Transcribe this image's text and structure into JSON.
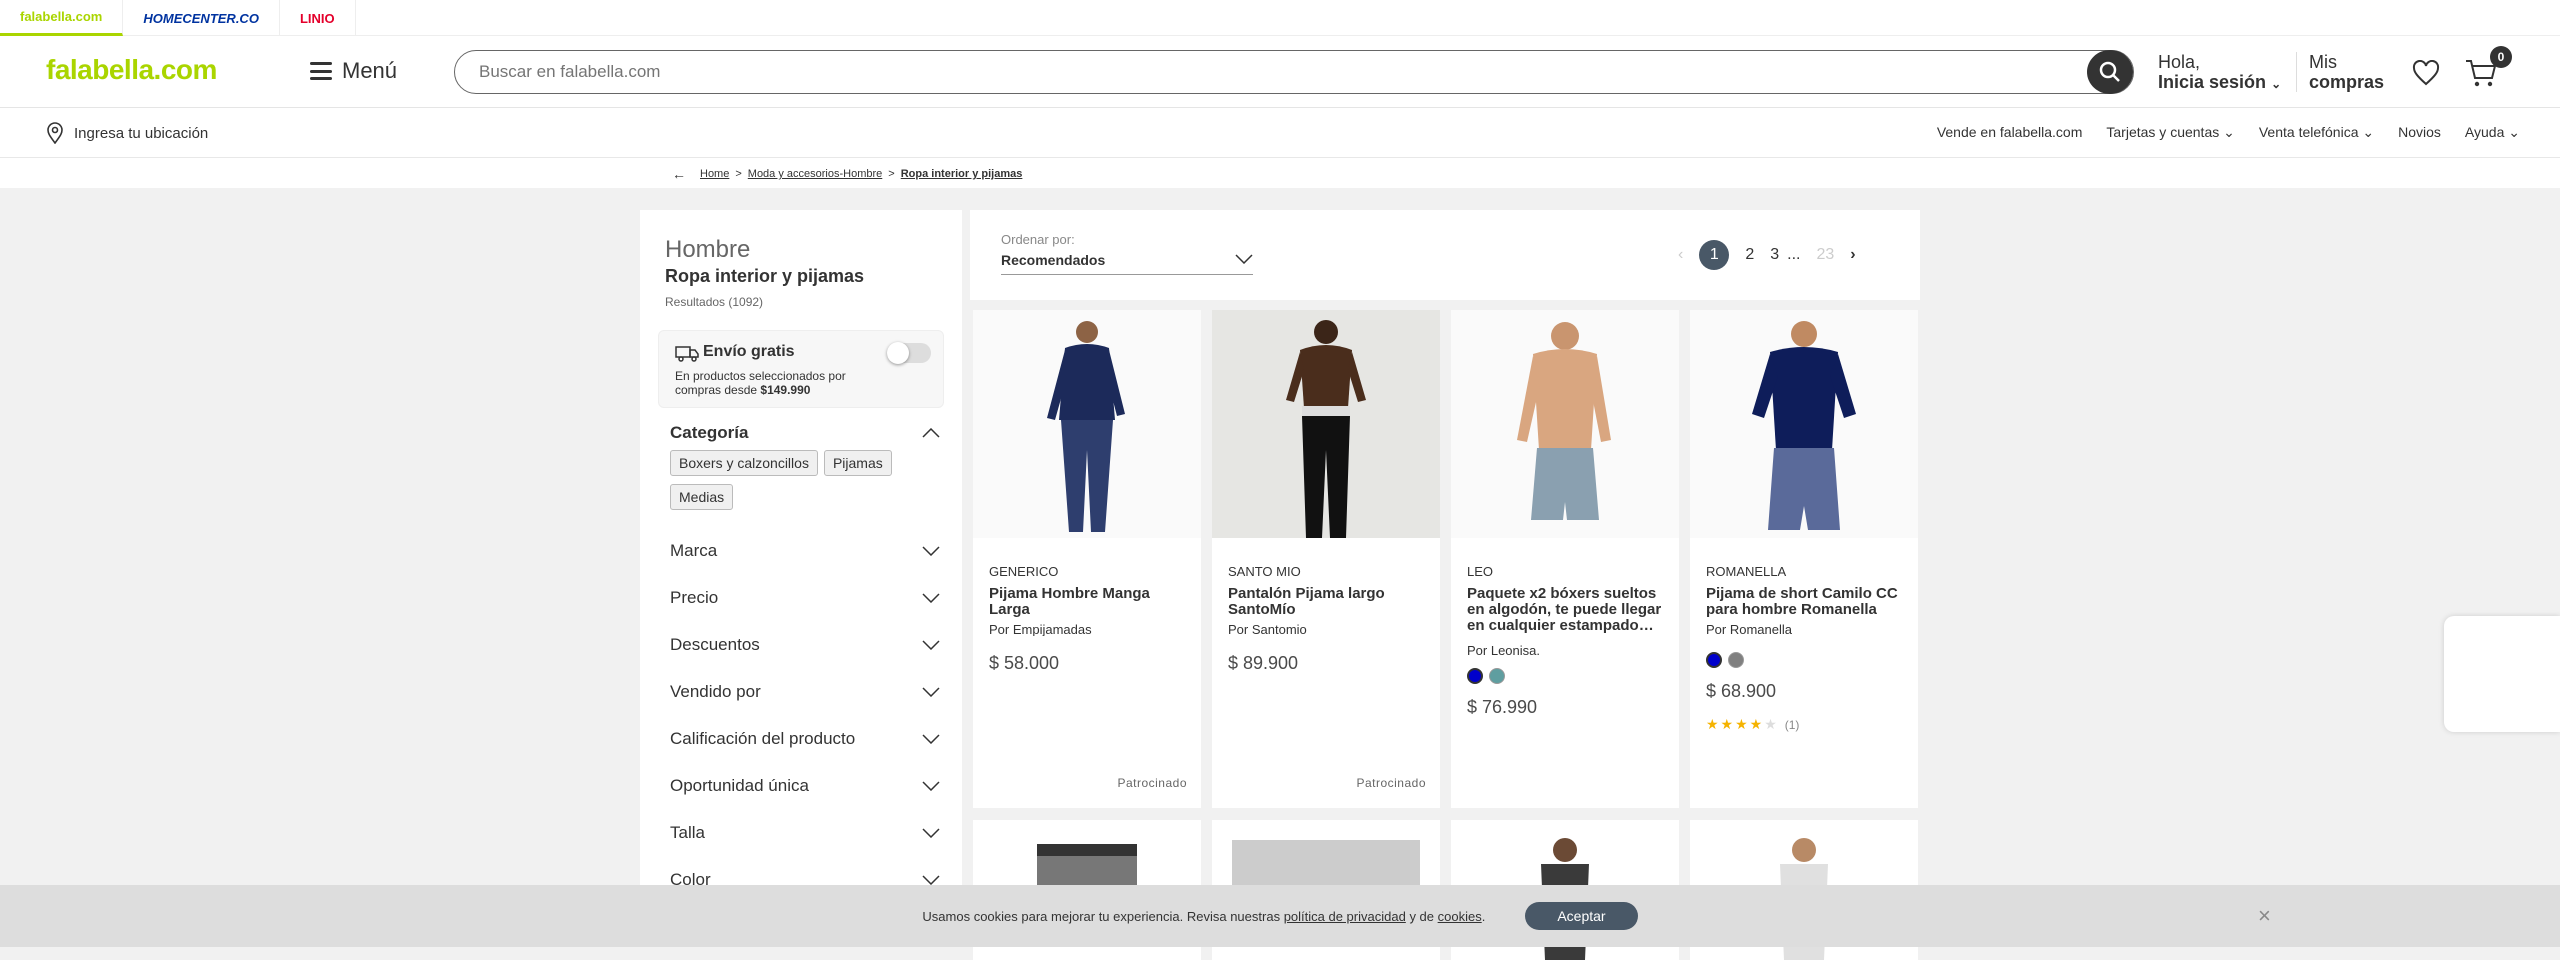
{
  "brands": [
    "falabella.com",
    "HOMECENTER.CO",
    "LINIO"
  ],
  "header": {
    "logo": "falabella.com",
    "menu_label": "Menú",
    "search_placeholder": "Buscar en falabella.com",
    "greeting": "Hola,",
    "login": "Inicia sesión",
    "purchases_1": "Mis",
    "purchases_2": "compras",
    "cart_count": "0"
  },
  "subnav": {
    "location": "Ingresa tu ubicación",
    "links": [
      "Vende en falabella.com",
      "Tarjetas y cuentas",
      "Venta telefónica",
      "Novios",
      "Ayuda"
    ]
  },
  "breadcrumb": [
    "Home",
    "Moda y accesorios-Hombre",
    "Ropa interior y pijamas"
  ],
  "sidebar": {
    "category": "Hombre",
    "subcategory": "Ropa interior y pijamas",
    "results": "Resultados (1092)",
    "shipping_title": "Envío gratis",
    "shipping_desc": "En productos seleccionados por compras desde ",
    "shipping_amount": "$149.990",
    "category_title": "Categoría",
    "chips": [
      "Boxers y calzoncillos",
      "Pijamas",
      "Medias"
    ],
    "filters": [
      "Marca",
      "Precio",
      "Descuentos",
      "Vendido por",
      "Calificación del producto",
      "Oportunidad única",
      "Talla",
      "Color"
    ]
  },
  "sort": {
    "label": "Ordenar por:",
    "value": "Recomendados"
  },
  "pagination": {
    "pages": [
      "1",
      "2",
      "3"
    ],
    "ellipsis": "...",
    "last": "23",
    "current": "1"
  },
  "products": [
    {
      "brand": "GENERICO",
      "name": "Pijama Hombre Manga Larga",
      "seller": "Por Empijamadas",
      "price": "$ 58.000",
      "tag": "Patrocinado"
    },
    {
      "brand": "SANTO MIO",
      "name": "Pantalón Pijama largo SantoMío",
      "seller": "Por Santomio",
      "price": "$ 89.900",
      "tag": "Patrocinado"
    },
    {
      "brand": "LEO",
      "name": "Paquete x2 bóxers sueltos en algodón, te puede llegar en cualquier estampado…",
      "seller": "Por Leonisa.",
      "price": "$ 76.990",
      "swatches": [
        "#0000cc",
        "#5f9ea0"
      ]
    },
    {
      "brand": "ROMANELLA",
      "name": "Pijama de short Camilo CC para hombre Romanella",
      "seller": "Por Romanella",
      "price": "$ 68.900",
      "swatches": [
        "#0000cc",
        "#808080"
      ],
      "rating": 4,
      "reviews": "(1)"
    }
  ],
  "cookie": {
    "text1": "Usamos cookies para mejorar tu experiencia. Revisa nuestras ",
    "link1": "política de privacidad",
    "text2": " y de ",
    "link2": "cookies",
    "text3": ".",
    "accept": "Aceptar"
  },
  "colors": {
    "brand_green": "#aad500",
    "dark": "#333333",
    "accent_slate": "#495867"
  }
}
